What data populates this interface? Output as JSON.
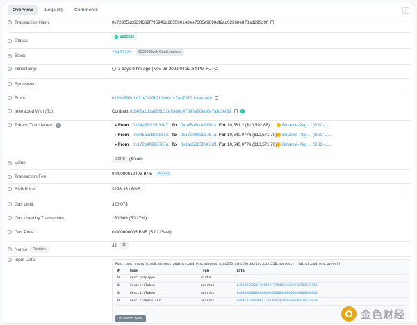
{
  "tabs": [
    {
      "label": "Overview"
    },
    {
      "label": "Logs (8)"
    },
    {
      "label": "Comments"
    }
  ],
  "menu_glyph": "⋮",
  "fields": {
    "tx_hash": {
      "label": "Transaction Hash:",
      "value": "0x72905bd839f682f795946d285500143ee7605e9690df2ad02968e878ad290d9f"
    },
    "status": {
      "label": "Status:",
      "value": "Success"
    },
    "block": {
      "label": "Block:",
      "value": "23450123",
      "confirmations": "96338 Block Confirmations"
    },
    "timestamp": {
      "label": "Timestamp:",
      "value": "3 days 9 hrs ago (Nov-28-2022 04:32:54 PM +UTC)"
    },
    "sponsored": {
      "label": "Sponsored:"
    },
    "from": {
      "label": "From:",
      "value": "0x89e692c1b31e7f03b7b9cbb1c7ab7872ddeedd49"
    },
    "interacted": {
      "label": "Interacted With (To):",
      "prefix": "Contract",
      "value": "0xb45a2dda996c32e93b8c47098e90ed0e7ab19e39"
    },
    "tokens": {
      "label": "Tokens Transferred:",
      "count": "3",
      "rows": [
        {
          "from_kw": "From",
          "from": "0x89e692c1b31e7...",
          "to_kw": "To",
          "to": "0xb45a2dda996c3...",
          "for_kw": "For",
          "amount": "10,561.2 ($10,592.88)",
          "token": "Binance-Peg ... (BSC-U..."
        },
        {
          "from_kw": "From",
          "from": "0xb45a2dda996c3...",
          "to_kw": "To",
          "to": "0x172b409987b7a...",
          "for_kw": "For",
          "amount": "10,540.0776 ($10,571.70)",
          "token": "Binance-Peg ... (BSC-U..."
        },
        {
          "from_kw": "From",
          "from": "0x172b409987b7a...",
          "to_kw": "To",
          "to": "0x1ad5685f345b2f...",
          "for_kw": "For",
          "amount": "10,540.0776 ($10,571.70)",
          "token": "Binance-Peg ... (BSC-U..."
        }
      ]
    },
    "value": {
      "label": "Value:",
      "value": "0 BNB",
      "usd": "($0.00)"
    },
    "fee": {
      "label": "Transaction Fee:",
      "value": "0.00080612403 BNB",
      "usd": "($0.24)"
    },
    "bnb_price": {
      "label": "BNB Price:",
      "value": "$293.35 / BNB"
    },
    "gas_limit": {
      "label": "Gas Limit:",
      "value": "320,073"
    },
    "gas_used": {
      "label": "Gas Used by Transaction:",
      "value": "160,909 (50.27%)"
    },
    "gas_price": {
      "label": "Gas Price:",
      "value": "0.000000005 BNB (5.01 Gwei)"
    },
    "nonce": {
      "label": "Nonce",
      "badge": "Position",
      "value": "32",
      "position": "10"
    },
    "input": {
      "label": "Input Data:",
      "function": "Function: cross(uint8,address,address,address,address,uint256,uint256,string,uint256,address), (uint8,address,bytes))",
      "headers": [
        "#",
        "Name",
        "Type",
        "Data"
      ],
      "params": [
        {
          "idx": "0",
          "name": "desc.swapType",
          "type": "uint8",
          "data": "3"
        },
        {
          "idx": "0",
          "name": "desc.srcToken",
          "type": "address",
          "data": "0x55d398326f99059fF775485246999027B3197955"
        },
        {
          "idx": "0",
          "name": "desc.dstToken",
          "type": "address",
          "data": "0x0000000000000000000000000000000000000000"
        },
        {
          "idx": "0",
          "name": "desc.srcReceiver",
          "type": "address",
          "data": "0xb45a2dda996c32e93b8c47098e90ed0e7ab19e39"
        }
      ],
      "switch_label": "Switch Back"
    }
  },
  "watermark": "金色财经"
}
